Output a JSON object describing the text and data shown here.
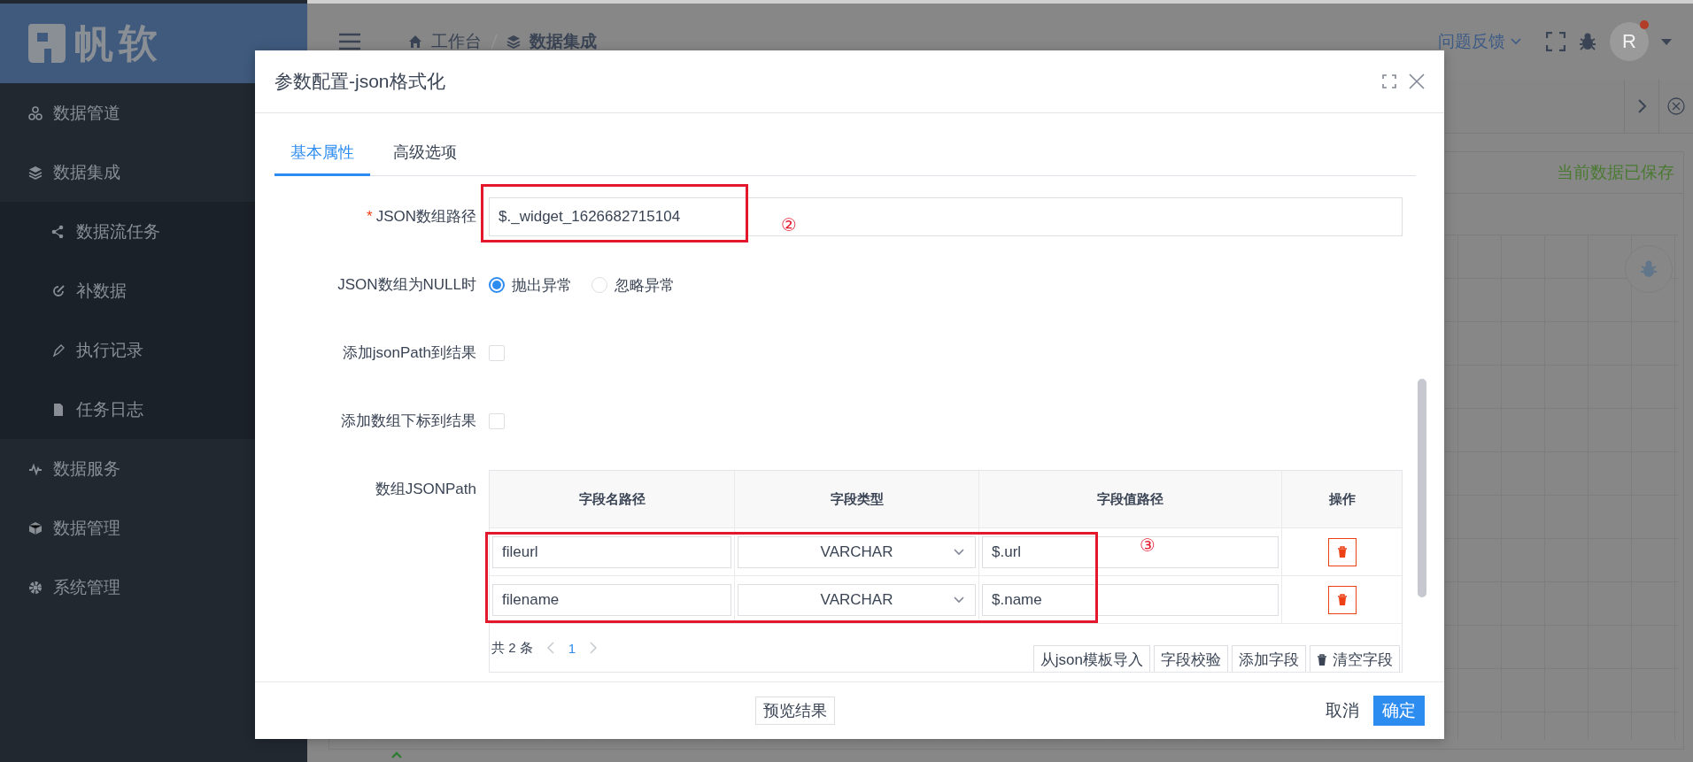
{
  "sidebar": {
    "logo_text": "帆软",
    "items": [
      {
        "label": "数据管道"
      },
      {
        "label": "数据集成",
        "children": [
          {
            "label": "数据流任务"
          },
          {
            "label": "补数据"
          },
          {
            "label": "执行记录"
          },
          {
            "label": "任务日志"
          }
        ]
      },
      {
        "label": "数据服务"
      },
      {
        "label": "数据管理"
      },
      {
        "label": "系统管理"
      }
    ]
  },
  "header": {
    "breadcrumb": [
      "工作台",
      "数据集成"
    ],
    "feedback": "问题反馈",
    "avatar": "R",
    "notification": true
  },
  "workspace": {
    "status": "当前数据已保存"
  },
  "dialog": {
    "title": "参数配置-json格式化",
    "tabs": [
      {
        "label": "基本属性",
        "selected": true
      },
      {
        "label": "高级选项",
        "selected": false
      }
    ],
    "fields": [
      {
        "kind": "text",
        "label": "JSON数组路径",
        "required_mark": "*",
        "value": "$._widget_1626682715104"
      },
      {
        "kind": "radio",
        "label": "JSON数组为NULL时",
        "options": [
          {
            "label": "抛出异常",
            "selected": true
          },
          {
            "label": "忽略异常",
            "selected": false
          }
        ]
      },
      {
        "kind": "checkbox",
        "label": "添加jsonPath到结果",
        "checked": false
      },
      {
        "kind": "checkbox",
        "label": "添加数组下标到结果",
        "checked": false
      },
      {
        "kind": "table",
        "label": "数组JSONPath",
        "columns": [
          "字段名路径",
          "字段类型",
          "字段值路径",
          "操作"
        ],
        "rows": [
          {
            "name": "fileurl",
            "type": "VARCHAR",
            "value_path": "$.url"
          },
          {
            "name": "filename",
            "type": "VARCHAR",
            "value_path": "$.name"
          }
        ],
        "total": "共 2 条",
        "pages": [
          {
            "label": "1",
            "selected": true
          }
        ],
        "actions": [
          "从json模板导入",
          "字段校验",
          "添加字段",
          "清空字段"
        ]
      }
    ],
    "preview": "预览结果",
    "cancel": "取消",
    "confirm": "确定"
  },
  "annotations": [
    {
      "label": "②"
    },
    {
      "label": "③"
    }
  ]
}
